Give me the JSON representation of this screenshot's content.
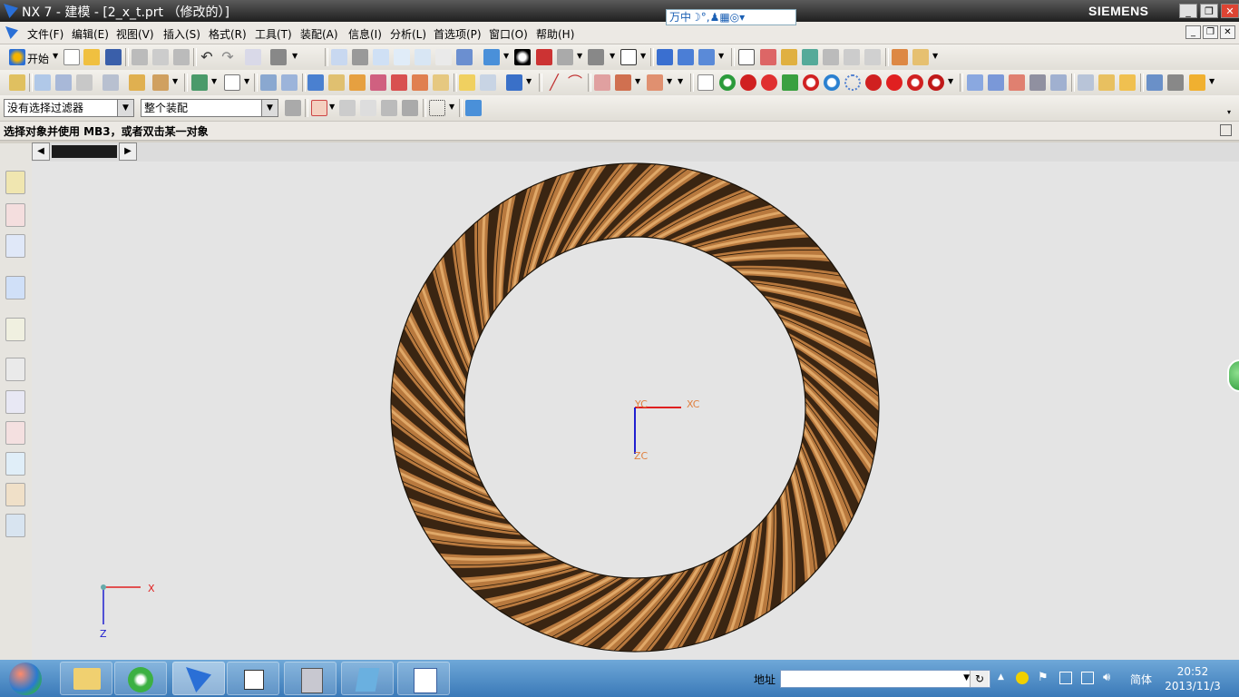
{
  "window": {
    "title": "NX 7 - 建模 - [2_x_t.prt （修改的）]",
    "brand": "SIEMENS"
  },
  "ime_bar": {
    "text": "万中☽°,♟▦◎▾"
  },
  "menu": {
    "items": [
      "文件(F)",
      "编辑(E)",
      "视图(V)",
      "插入(S)",
      "格式(R)",
      "工具(T)",
      "装配(A)",
      "信息(I)",
      "分析(L)",
      "首选项(P)",
      "窗口(O)",
      "帮助(H)"
    ]
  },
  "toolbar1": {
    "start_label": "开始"
  },
  "toolbar3": {
    "filter_value": "没有选择过滤器",
    "scope_value": "整个装配"
  },
  "status": {
    "message": "选择对象并使用 MB3，或者双击某一对象"
  },
  "viewport": {
    "wcs_labels": {
      "x": "XC",
      "y": "YC",
      "z": "ZC"
    },
    "triad_labels": {
      "x": "X",
      "z": "Z"
    },
    "gear_color": "#b8793e",
    "gear_dark": "#3a2512",
    "tooth_count": 48
  },
  "taskbar": {
    "address_label": "地址",
    "lang": "简体",
    "time": "20:52",
    "date": "2013/11/3"
  },
  "colors": {
    "titlebar": "#2b2b2b",
    "taskbar": "#4f8fc9",
    "viewport_bg": "#e4e4e4"
  }
}
